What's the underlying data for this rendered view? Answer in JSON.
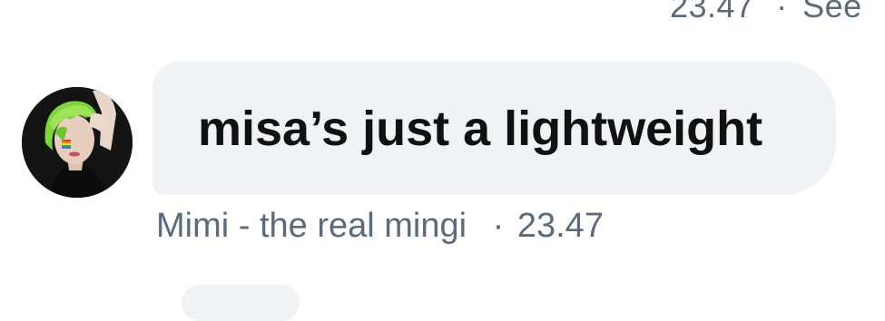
{
  "previous_message": {
    "time": "23.47",
    "separator": "·",
    "action": "See"
  },
  "message": {
    "text": "misa’s just a lightweight",
    "author": "Mimi - the real mingi",
    "separator": "·",
    "time": "23.47"
  },
  "avatar": {
    "icon": "profile-photo-green-hair"
  },
  "colors": {
    "bubble": "#f0f2f5",
    "meta_text": "#5b6b7b",
    "message_text": "#111111"
  }
}
